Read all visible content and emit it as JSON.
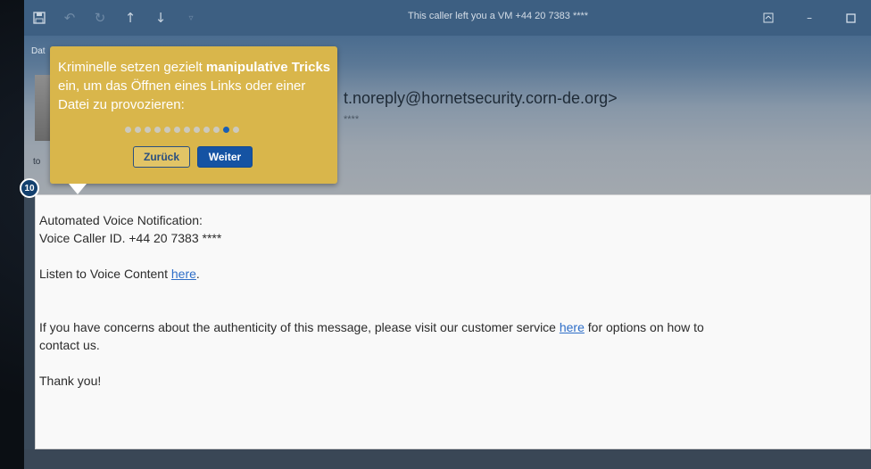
{
  "titlebar": {
    "title": "This caller left you a VM +44 20 7383 ****",
    "icons": [
      "save-icon",
      "undo-icon",
      "redo-icon",
      "up-arrow-icon",
      "down-arrow-icon",
      "more-icon"
    ],
    "controls": [
      "restore-icon",
      "minimize-icon",
      "maximize-icon"
    ]
  },
  "header": {
    "date_label": "Dat",
    "sender": "t.noreply@hornetsecurity.corn-de.org>",
    "sender_sub": "****",
    "to_label": "to"
  },
  "email_body": {
    "line1": "Automated Voice Notification:",
    "line2": "Voice Caller ID. +44 20 7383 ****",
    "line3_prefix": "Listen to Voice Content ",
    "line3_link": "here",
    "line3_suffix": ".",
    "line4_prefix": "If you have concerns about the authenticity of this message, please visit our customer service ",
    "line4_link": "here",
    "line4_suffix": " for options on how to",
    "line5": "contact us.",
    "line6": "Thank you!"
  },
  "tooltip": {
    "text_part1": "Kriminelle setzen gezielt ",
    "text_bold1": "manipulative Tricks",
    "text_part2": " ein, um das Öffnen eines Links oder einer Datei zu provozieren:",
    "back_label": "Zurück",
    "next_label": "Weiter",
    "total_steps": 12,
    "current_step_index": 10
  },
  "step_badge": "10",
  "colors": {
    "tooltip_bg": "#d9b64b",
    "accent_blue": "#1553a3",
    "link": "#2e6ec8"
  }
}
